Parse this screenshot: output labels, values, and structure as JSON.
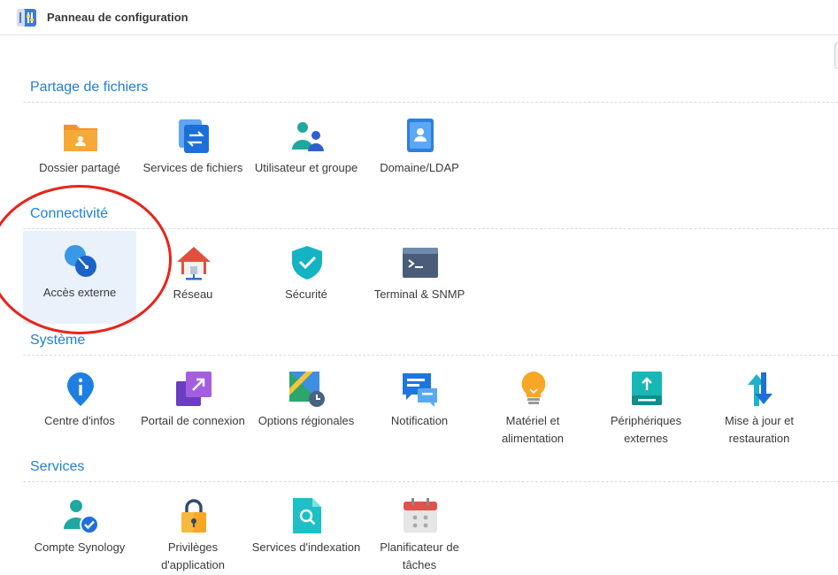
{
  "window": {
    "title": "Panneau de configuration"
  },
  "sections": [
    {
      "title": "Partage de fichiers",
      "items": [
        {
          "label": "Dossier partagé",
          "icon": "shared-folder-icon"
        },
        {
          "label": "Services de fichiers",
          "icon": "file-services-icon"
        },
        {
          "label": "Utilisateur et groupe",
          "icon": "user-group-icon"
        },
        {
          "label": "Domaine/LDAP",
          "icon": "domain-ldap-icon"
        }
      ]
    },
    {
      "title": "Connectivité",
      "items": [
        {
          "label": "Accès externe",
          "icon": "external-access-icon",
          "selected": true
        },
        {
          "label": "Réseau",
          "icon": "network-icon"
        },
        {
          "label": "Sécurité",
          "icon": "security-shield-icon"
        },
        {
          "label": "Terminal & SNMP",
          "icon": "terminal-icon"
        }
      ]
    },
    {
      "title": "Système",
      "items": [
        {
          "label": "Centre d'infos",
          "icon": "info-center-icon"
        },
        {
          "label": "Portail de connexion",
          "icon": "login-portal-icon"
        },
        {
          "label": "Options régionales",
          "icon": "regional-options-icon"
        },
        {
          "label": "Notification",
          "icon": "notification-icon"
        },
        {
          "label": "Matériel et alimentation",
          "icon": "hardware-power-icon"
        },
        {
          "label": "Périphériques externes",
          "icon": "external-devices-icon"
        },
        {
          "label": "Mise à jour et restauration",
          "icon": "update-restore-icon"
        }
      ]
    },
    {
      "title": "Services",
      "items": [
        {
          "label": "Compte Synology",
          "icon": "synology-account-icon"
        },
        {
          "label": "Privilèges d'application",
          "icon": "app-privileges-icon"
        },
        {
          "label": "Services d'indexation",
          "icon": "indexing-service-icon"
        },
        {
          "label": "Planificateur de tâches",
          "icon": "task-scheduler-icon"
        }
      ]
    }
  ],
  "colors": {
    "accent": "#1f7fd6",
    "selected_bg": "#e9f1fb",
    "annotation": "#e8241c"
  }
}
